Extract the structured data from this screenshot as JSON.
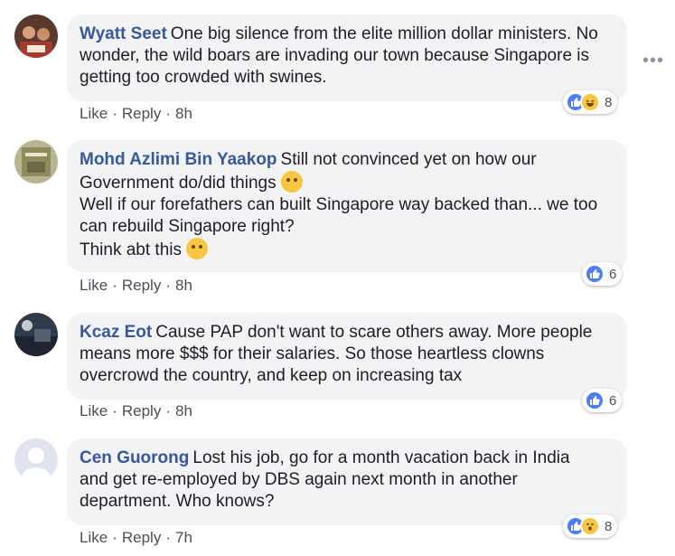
{
  "menu": {
    "more_label": "•••"
  },
  "comments": [
    {
      "author": "Wyatt Seet",
      "lines": [
        "One big silence from the elite million dollar ministers. No",
        "wonder, the wild boars are invading our town because Singapore is",
        "getting too crowded with swines."
      ],
      "like_label": "Like",
      "reply_label": "Reply",
      "separator": "·",
      "time": "8h",
      "reaction_count": "8"
    },
    {
      "author": "Mohd Azlimi Bin Yaakop",
      "lines": [
        "Still not convinced yet on how our",
        "Government do/did things",
        "Well if our forefathers can built Singapore way backed than... we too",
        "can rebuild Singapore right?",
        "Think abt this"
      ],
      "like_label": "Like",
      "reply_label": "Reply",
      "separator": "·",
      "time": "8h",
      "reaction_count": "6"
    },
    {
      "author": "Kcaz Eot",
      "lines": [
        "Cause PAP don't want to scare others away. More people",
        "means more $$$ for their salaries. So those heartless clowns",
        "overcrowd the country, and keep on increasing tax"
      ],
      "like_label": "Like",
      "reply_label": "Reply",
      "separator": "·",
      "time": "8h",
      "reaction_count": "6"
    },
    {
      "author": "Cen Guorong",
      "lines": [
        "Lost his job, go for a month vacation back in India",
        "and get re-employed by DBS again next month in another",
        "department. Who knows?"
      ],
      "like_label": "Like",
      "reply_label": "Reply",
      "separator": "·",
      "time": "7h",
      "reaction_count": "8"
    }
  ],
  "colors": {
    "author": "#385898",
    "bubble": "#f2f3f5",
    "like": "#4d7ef6"
  }
}
